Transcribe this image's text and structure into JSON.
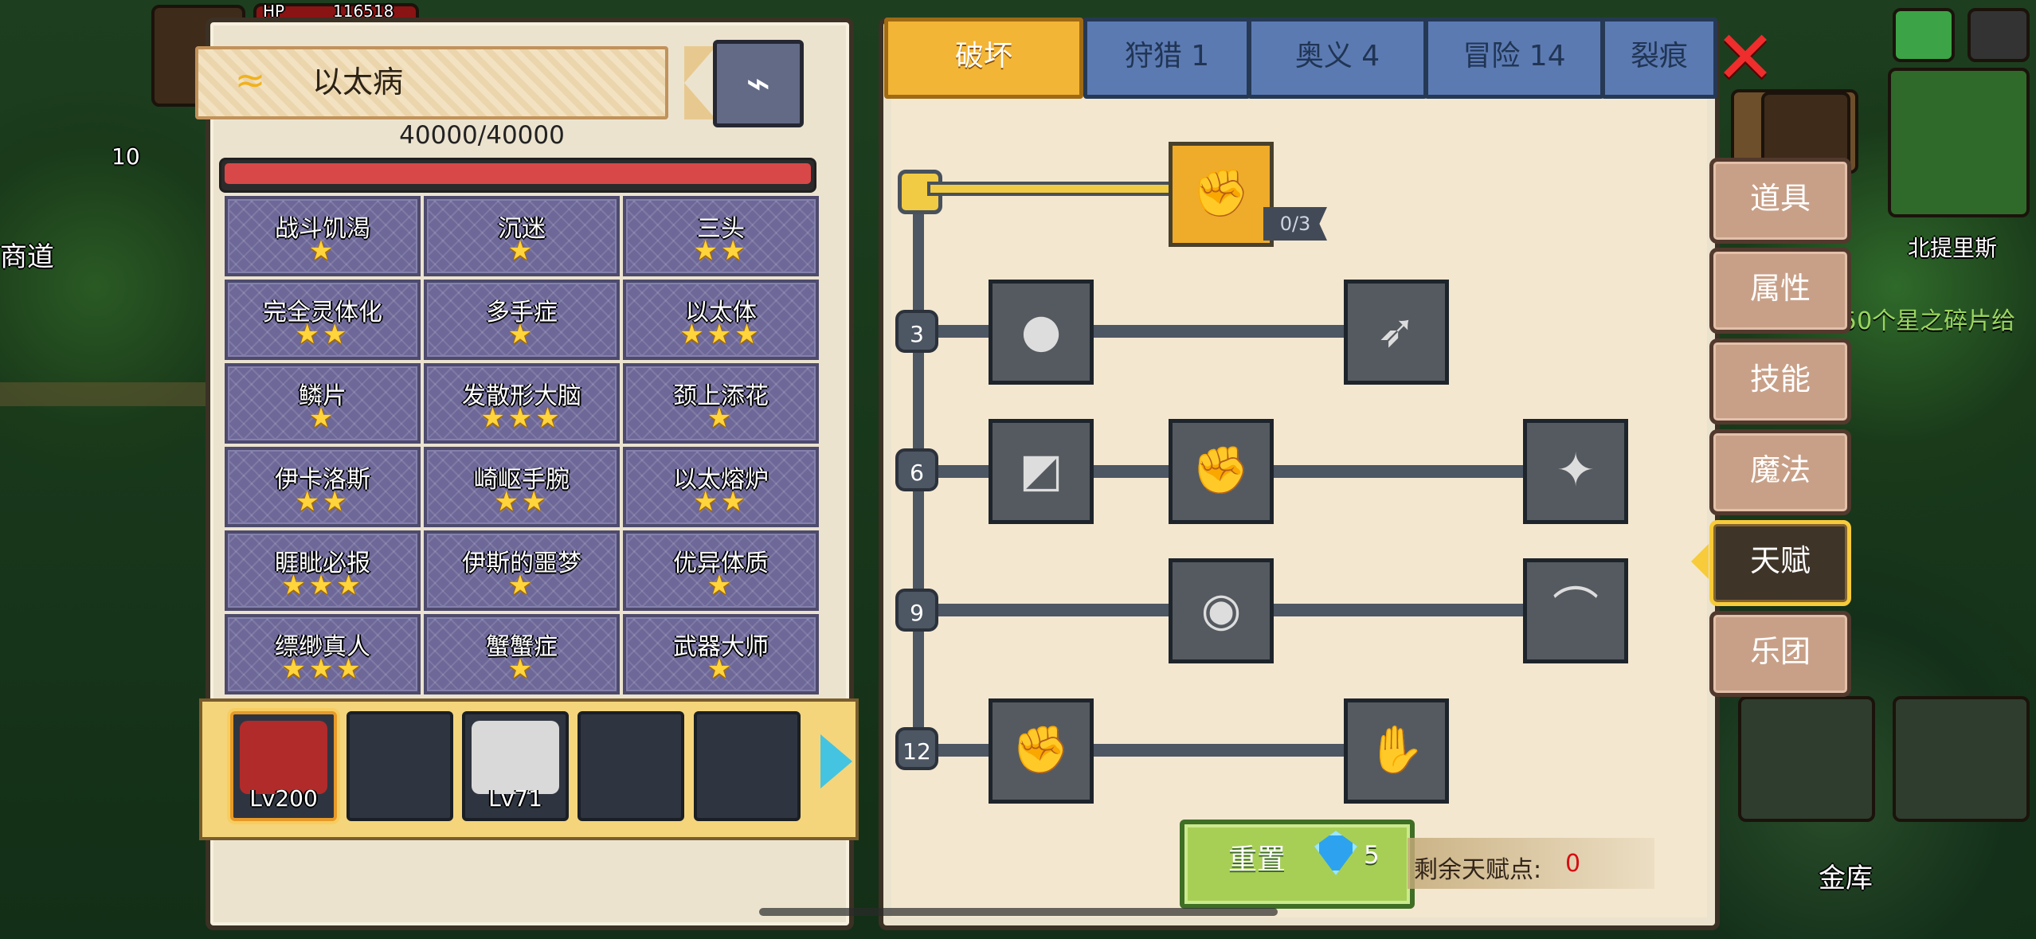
{
  "background": {
    "left_label": "商道",
    "left_number": "10",
    "right_location": "北提里斯",
    "right_announcement": "50个星之碎片给",
    "top_hp_label": "HP",
    "top_hp_value": "116518",
    "bottom_right_label": "金库"
  },
  "left": {
    "disease_name": "以太病",
    "hp_text": "40000/40000",
    "hp_fraction": 1.0,
    "mutations": [
      {
        "name": "战斗饥渴",
        "stars": "★"
      },
      {
        "name": "沉迷",
        "stars": "★"
      },
      {
        "name": "三头",
        "stars": "★★"
      },
      {
        "name": "完全灵体化",
        "stars": "★★"
      },
      {
        "name": "多手症",
        "stars": "★"
      },
      {
        "name": "以太体",
        "stars": "★★★"
      },
      {
        "name": "鳞片",
        "stars": "★"
      },
      {
        "name": "发散形大脑",
        "stars": "★★★"
      },
      {
        "name": "颈上添花",
        "stars": "★"
      },
      {
        "name": "伊卡洛斯",
        "stars": "★★"
      },
      {
        "name": "崎岖手腕",
        "stars": "★★"
      },
      {
        "name": "以太熔炉",
        "stars": "★★"
      },
      {
        "name": "睚眦必报",
        "stars": "★★★"
      },
      {
        "name": "伊斯的噩梦",
        "stars": "★"
      },
      {
        "name": "优异体质",
        "stars": "★"
      },
      {
        "name": "缥缈真人",
        "stars": "★★★"
      },
      {
        "name": "蟹蟹症",
        "stars": "★"
      },
      {
        "name": "武器大师",
        "stars": "★"
      }
    ],
    "team": [
      {
        "level": "Lv200"
      },
      {
        "level": ""
      },
      {
        "level": "Lv71"
      },
      {
        "level": ""
      },
      {
        "level": ""
      }
    ]
  },
  "tabs": [
    {
      "label": "破坏"
    },
    {
      "label": "狩猎 1"
    },
    {
      "label": "奥义 4"
    },
    {
      "label": "冒险 14"
    },
    {
      "label": "裂痕"
    }
  ],
  "tree": {
    "levels": [
      "3",
      "6",
      "9",
      "12"
    ],
    "top_counter": "0/3"
  },
  "reset": {
    "label": "重置",
    "cost": "5"
  },
  "remaining": {
    "label": "剩余天赋点:",
    "value": "0"
  },
  "side_menu": [
    {
      "label": "道具"
    },
    {
      "label": "属性"
    },
    {
      "label": "技能"
    },
    {
      "label": "魔法"
    },
    {
      "label": "天赋"
    },
    {
      "label": "乐团"
    }
  ],
  "icons": {
    "close": "close-icon",
    "syringe": "syringe-icon",
    "wind": "wind-icon",
    "gem": "gem-icon",
    "arm_wrestle": "arm-wrestle-icon",
    "muscle": "muscle-icon",
    "arrow": "arrow-icon",
    "shield": "shield-icon",
    "fist": "fist-icon",
    "splash": "splash-icon",
    "ring": "ring-icon",
    "bat": "bat-icon",
    "hand": "hand-icon",
    "right_arrow": "right-arrow-icon"
  }
}
